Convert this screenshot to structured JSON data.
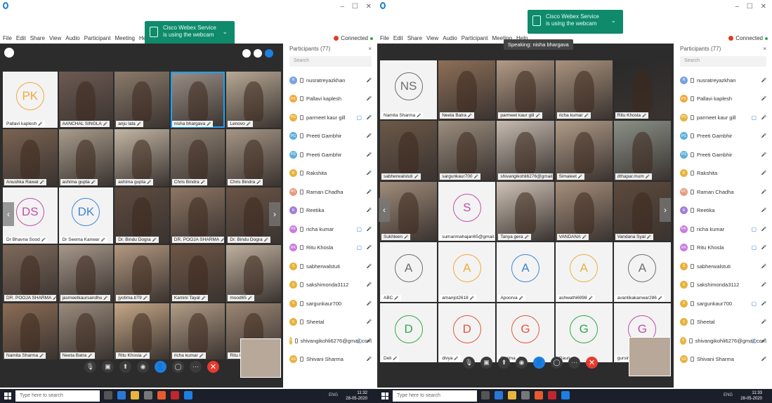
{
  "left": {
    "toast": {
      "line1": "Cisco Webex Service",
      "line2": "is using the webcam"
    },
    "menu": [
      "File",
      "Edit",
      "Share",
      "View",
      "Audio",
      "Participant",
      "Meeting",
      "Help"
    ],
    "connected": "Connected",
    "window_controls": "– ☐ ✕",
    "tiles": [
      {
        "name": "Pallavi kaplesh",
        "initials": "PK",
        "avatar": true,
        "color": "#f2a93b"
      },
      {
        "name": "AANCHAL SINGLA",
        "bg": "#6d5a52"
      },
      {
        "name": "anju lata",
        "bg": "#8a7a6a"
      },
      {
        "name": "nisha bhargava",
        "bg": "#9b8f87",
        "active": true
      },
      {
        "name": "Lenovo",
        "bg": "#b8a995"
      },
      {
        "name": "Anushka Rawat",
        "bg": "#7b6352"
      },
      {
        "name": "ashima gupta",
        "bg": "#a99c8c"
      },
      {
        "name": "ashima gupta",
        "bg": "#c3b6a4"
      },
      {
        "name": "Chris Bindra",
        "bg": "#8f8274"
      },
      {
        "name": "Chris Bindra",
        "bg": "#a59585"
      },
      {
        "name": "Dr Bhavna Sood",
        "initials": "DS",
        "avatar": true,
        "color": "#c24ea9"
      },
      {
        "name": "Dr Seema Kanwar",
        "initials": "DK",
        "avatar": true,
        "color": "#3d86d6"
      },
      {
        "name": "Dr. Bindu Dogra",
        "bg": "#5e4b3f"
      },
      {
        "name": "DR. POOJA SHARMA",
        "bg": "#8e7664"
      },
      {
        "name": "Dr. Bindu Dogra",
        "bg": "#6b5546"
      },
      {
        "name": "DR. POOJA SHARMA",
        "bg": "#7f6a5b"
      },
      {
        "name": "jasmeetkaursandhu",
        "bg": "#a6978a"
      },
      {
        "name": "jyotima.bT9",
        "bg": "#b39880"
      },
      {
        "name": "Kamini Tayal",
        "bg": "#6f5646"
      },
      {
        "name": "mood65",
        "bg": "#bfb09e"
      },
      {
        "name": "Namita Sharma",
        "bg": "#8b6d55"
      },
      {
        "name": "Neeta Batra",
        "bg": "#9a8b7c"
      },
      {
        "name": "Ritu Khosla",
        "bg": "#c4a786"
      },
      {
        "name": "richa kumar",
        "bg": "#b29d87"
      },
      {
        "name": "Ritu k",
        "bg": "#9c8774"
      }
    ],
    "participants_header": "Participants (77)",
    "search_placeholder": "Search",
    "participants": [
      {
        "badge": "N",
        "name": "nusratreyazkhan",
        "color": "#7aa3e0"
      },
      {
        "badge": "PK",
        "name": "Pallavi kaplesh",
        "color": "#f2a93b"
      },
      {
        "badge": "PG",
        "name": "parmeet kaur gill",
        "color": "#e7b23c",
        "cam": true
      },
      {
        "badge": "PG",
        "name": "Preeti Gambhir",
        "color": "#5cb0d9"
      },
      {
        "badge": "PG",
        "name": "Preeti Gambhir",
        "color": "#5cb0d9"
      },
      {
        "badge": "R",
        "name": "Rakshita",
        "color": "#e7b23c"
      },
      {
        "badge": "RC",
        "name": "Raman Chadha",
        "color": "#e59a7e"
      },
      {
        "badge": "R",
        "name": "Reetika",
        "color": "#9f7fd9"
      },
      {
        "badge": "RK",
        "name": "richa kumar",
        "color": "#c77be0",
        "cam": true
      },
      {
        "badge": "RK",
        "name": "Ritu Khosla",
        "color": "#c77be0",
        "cam": true
      },
      {
        "badge": "S",
        "name": "sabherwalstuti",
        "color": "#e7b23c"
      },
      {
        "badge": "S",
        "name": "sakshimonda3112",
        "color": "#e7b23c"
      },
      {
        "badge": "S",
        "name": "sargunkaur700",
        "color": "#e7b23c"
      },
      {
        "badge": "S",
        "name": "Sheetal",
        "color": "#e7b23c"
      },
      {
        "badge": "S",
        "name": "shivangikohli6276@gmail.com",
        "color": "#e7b23c",
        "cam": true
      },
      {
        "badge": "SS",
        "name": "Shivani Sharma",
        "color": "#e7b23c"
      }
    ],
    "taskbar": {
      "search": "Type here to search",
      "time": "11:32",
      "date": "28-05-2020",
      "tray": "ENG"
    }
  },
  "right": {
    "toast": {
      "line1": "Cisco Webex Service",
      "line2": "is using the webcam"
    },
    "menu": [
      "File",
      "Edit",
      "Share",
      "View",
      "Audio",
      "Participant",
      "Meeting",
      "Help"
    ],
    "connected": "Connected",
    "window_controls": "– ☐ ✕",
    "speaking": "Speaking: nisha bhargava",
    "tiles": [
      {
        "name": "Namita Sharma",
        "initials": "NS",
        "avatar": true,
        "color": "#6e6e6e"
      },
      {
        "name": "Neeta Batra",
        "bg": "#8d6f58"
      },
      {
        "name": "parmeet kaur gill",
        "bg": "#b29a86"
      },
      {
        "name": "richa kumar",
        "bg": "#a8927d"
      },
      {
        "name": "Ritu Khosla",
        "bg": "#2a2a2a"
      },
      {
        "name": "sabherwalstuti",
        "bg": "#6c5948"
      },
      {
        "name": "sargunkaur700",
        "bg": "#9c8e7e"
      },
      {
        "name": "shivangikohli6276@gmail.com",
        "bg": "#c6bbb0"
      },
      {
        "name": "Simaleet",
        "bg": "#b09b88"
      },
      {
        "name": "dthapar.mum",
        "bg": "#8a9187"
      },
      {
        "name": "Sukhleen",
        "bg": "#a08c7a"
      },
      {
        "name": "sumanmahajan65@gmail.com",
        "initials": "S",
        "avatar": true,
        "color": "#c24ea9"
      },
      {
        "name": "Tanya gera",
        "bg": "#cfc3b6"
      },
      {
        "name": "VANDANA",
        "bg": "#a68f7b"
      },
      {
        "name": "Vandana Syal",
        "bg": "#5d4a3c"
      },
      {
        "name": "ABC",
        "initials": "A",
        "avatar": true,
        "color": "#6e6e6e"
      },
      {
        "name": "amanjot2618",
        "initials": "A",
        "avatar": true,
        "color": "#f2a93b"
      },
      {
        "name": "Apoorva",
        "initials": "A",
        "avatar": true,
        "color": "#3d86d6"
      },
      {
        "name": "ashwathi6998",
        "initials": "A",
        "avatar": true,
        "color": "#e7b23c"
      },
      {
        "name": "avantikakanwar286",
        "initials": "A",
        "avatar": true,
        "color": "#6e6e6e"
      },
      {
        "name": "Deli",
        "initials": "D",
        "avatar": true,
        "color": "#2fa84f"
      },
      {
        "name": "divya",
        "initials": "D",
        "avatar": true,
        "color": "#e5553b"
      },
      {
        "name": "Garima",
        "initials": "G",
        "avatar": true,
        "color": "#e5553b"
      },
      {
        "name": "Gauri",
        "initials": "G",
        "avatar": true,
        "color": "#2fa84f"
      },
      {
        "name": "gursimran",
        "initials": "G",
        "avatar": true,
        "color": "#c24ea9"
      }
    ],
    "participants_header": "Participants (77)",
    "search_placeholder": "Search",
    "participants": [
      {
        "badge": "N",
        "name": "nusratreyazkhan",
        "color": "#7aa3e0"
      },
      {
        "badge": "PK",
        "name": "Pallavi kaplesh",
        "color": "#f2a93b"
      },
      {
        "badge": "PG",
        "name": "parmeet kaur gill",
        "color": "#e7b23c",
        "cam": true
      },
      {
        "badge": "PG",
        "name": "Preeti Gambhir",
        "color": "#5cb0d9"
      },
      {
        "badge": "PG",
        "name": "Preeti Gambhir",
        "color": "#5cb0d9"
      },
      {
        "badge": "R",
        "name": "Rakshita",
        "color": "#e7b23c"
      },
      {
        "badge": "RC",
        "name": "Raman Chadha",
        "color": "#e59a7e"
      },
      {
        "badge": "R",
        "name": "Reetika",
        "color": "#9f7fd9"
      },
      {
        "badge": "RK",
        "name": "richa kumar",
        "color": "#c77be0",
        "cam": true
      },
      {
        "badge": "RK",
        "name": "Ritu Khosla",
        "color": "#c77be0",
        "cam": true
      },
      {
        "badge": "S",
        "name": "sabherwalstuti",
        "color": "#e7b23c"
      },
      {
        "badge": "S",
        "name": "sakshimonda3112",
        "color": "#e7b23c"
      },
      {
        "badge": "S",
        "name": "sargunkaur700",
        "color": "#e7b23c",
        "cam": true
      },
      {
        "badge": "S",
        "name": "Sheetal",
        "color": "#e7b23c"
      },
      {
        "badge": "S",
        "name": "shivangikohli6276@gmail.com",
        "color": "#e7b23c",
        "cam": true
      },
      {
        "badge": "SS",
        "name": "Shivani Sharma",
        "color": "#e7b23c"
      }
    ],
    "taskbar": {
      "search": "Type here to search",
      "time": "11:33",
      "date": "28-05-2020",
      "tray": "ENG"
    }
  },
  "controls": [
    "mute-icon",
    "video-icon",
    "share-icon",
    "record-icon",
    "participants-icon",
    "chat-icon",
    "more-icon",
    "end-icon"
  ],
  "colors": {
    "accent": "#1d7fe0",
    "end": "#e63b2e",
    "toast": "#0f8a6a",
    "stage": "#2c2c2c"
  }
}
